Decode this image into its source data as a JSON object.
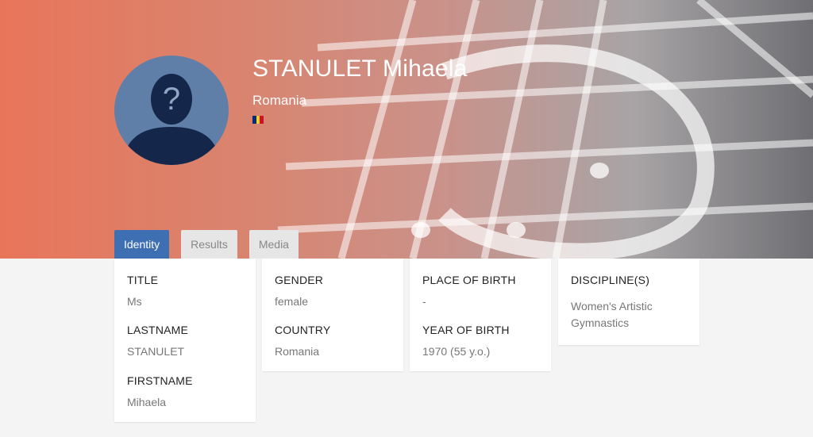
{
  "athlete": {
    "name": "STANULET Mihaela",
    "country": "Romania",
    "flag_colors": [
      "#002b7f",
      "#fcd116",
      "#ce1126"
    ]
  },
  "tabs": [
    {
      "label": "Identity",
      "active": true
    },
    {
      "label": "Results",
      "active": false
    },
    {
      "label": "Media",
      "active": false
    }
  ],
  "identity": {
    "title_label": "TITLE",
    "title_value": "Ms",
    "lastname_label": "LASTNAME",
    "lastname_value": "STANULET",
    "firstname_label": "FIRSTNAME",
    "firstname_value": "Mihaela",
    "gender_label": "GENDER",
    "gender_value": "female",
    "country_label": "COUNTRY",
    "country_value": "Romania",
    "pob_label": "PLACE OF BIRTH",
    "pob_value": "-",
    "yob_label": "YEAR OF BIRTH",
    "yob_value": "1970 (55 y.o.)",
    "discipline_label": "DISCIPLINE(S)",
    "discipline_value": "Women's Artistic Gymnastics"
  },
  "colors": {
    "accent": "#3f6fb3",
    "hero_start": "#e8755a",
    "hero_end": "#6f6f73"
  }
}
